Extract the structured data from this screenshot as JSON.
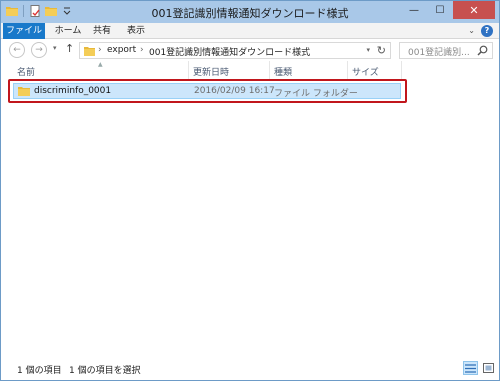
{
  "window": {
    "title": "001登記識別情報通知ダウンロード様式",
    "minimize_glyph": "—",
    "maximize_glyph": "☐",
    "close_glyph": "✕"
  },
  "ribbon": {
    "tabs": [
      {
        "label": "ファイル"
      },
      {
        "label": "ホーム"
      },
      {
        "label": "共有"
      },
      {
        "label": "表示"
      }
    ],
    "expand_glyph": "⌄",
    "help_glyph": "?"
  },
  "nav": {
    "back_glyph": "←",
    "forward_glyph": "→",
    "recent_glyph": "▾",
    "up_glyph": "↑",
    "path_separator": "›",
    "breadcrumbs": [
      "export",
      "001登記識別情報通知ダウンロード様式"
    ],
    "refresh_glyph": "↻",
    "search_placeholder": "001登記識別..."
  },
  "columns": {
    "name": "名前",
    "date": "更新日時",
    "type": "種類",
    "size": "サイズ"
  },
  "files": [
    {
      "name": "discriminfo_0001",
      "modified": "2016/02/09 16:17",
      "type": "ファイル フォルダー",
      "icon": "folder-icon"
    }
  ],
  "status": {
    "item_count": "1 個の項目",
    "selected_count": "1 個の項目を選択"
  },
  "colors": {
    "accent": "#1979ca",
    "selection": "#cce6fb",
    "highlight_border": "#c1161c",
    "titlebar": "#a9c8e8"
  }
}
